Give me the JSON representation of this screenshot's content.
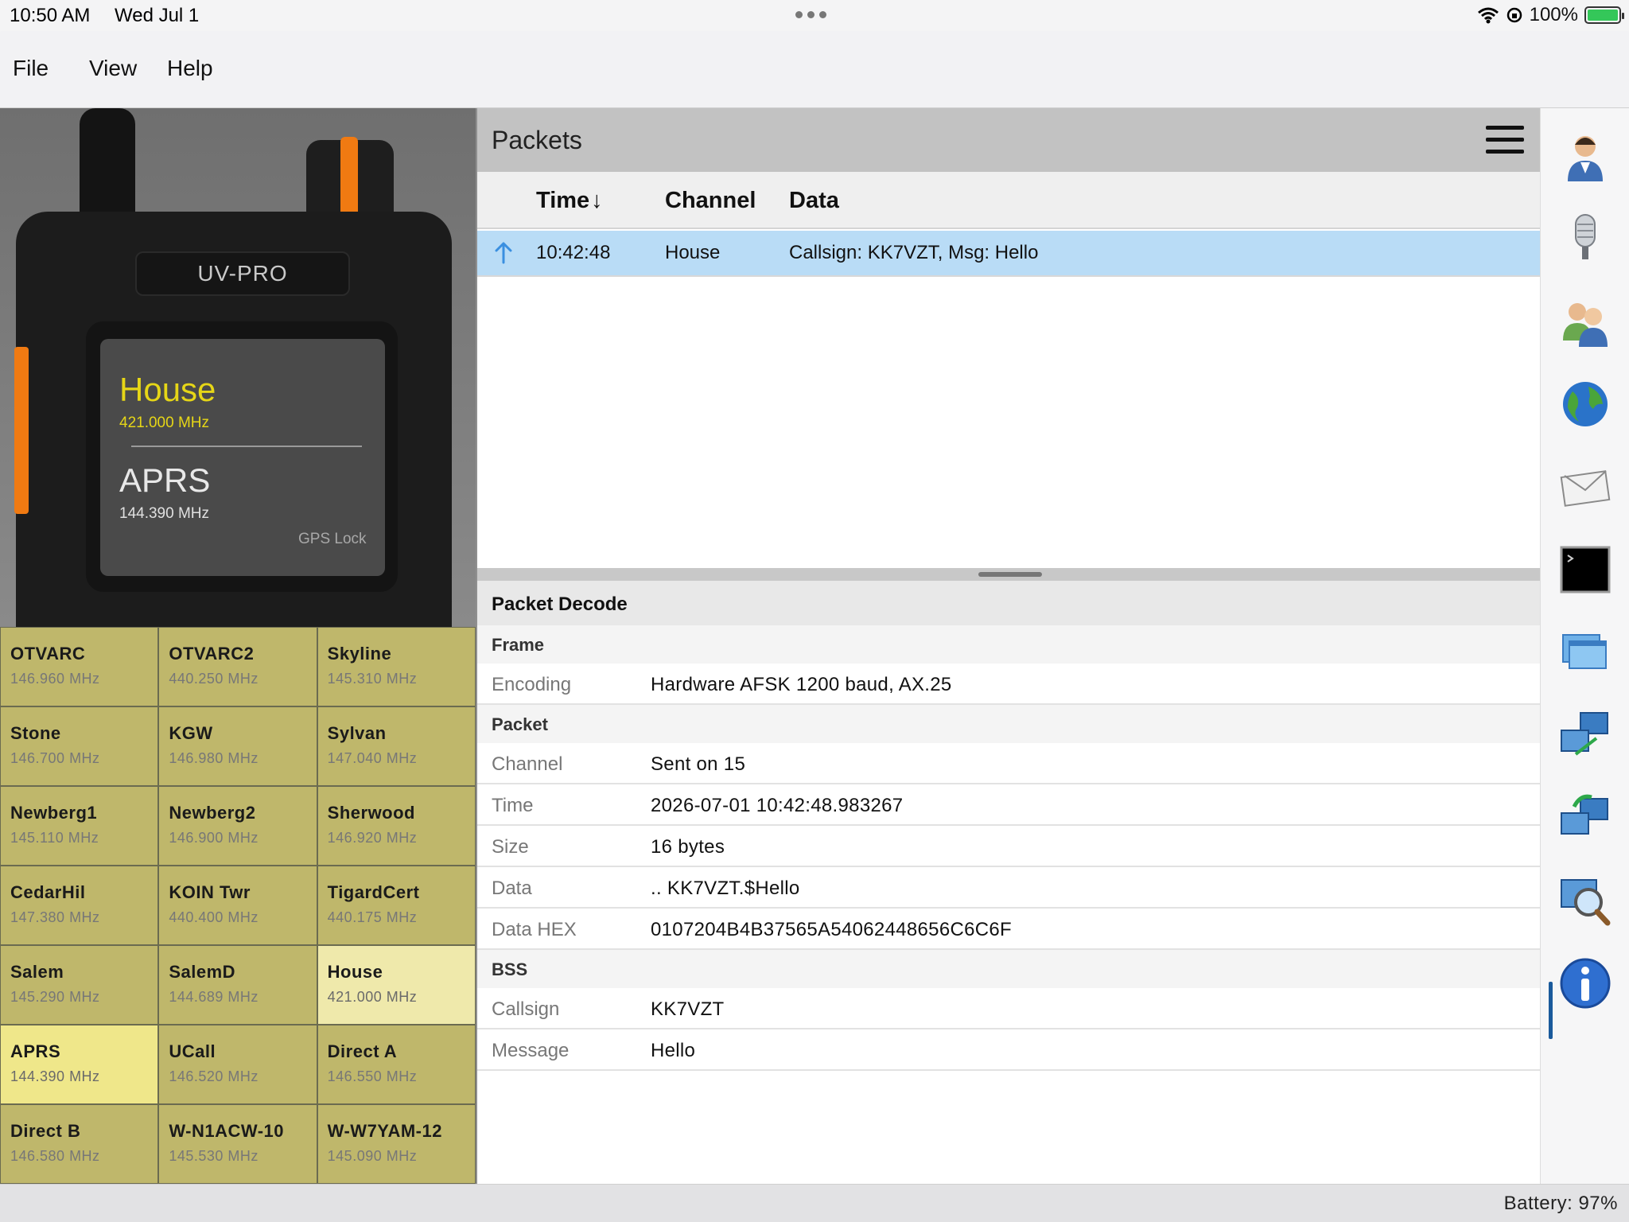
{
  "status_bar": {
    "time": "10:50 AM",
    "date": "Wed Jul 1",
    "battery": "100%"
  },
  "menu": {
    "file": "File",
    "view": "View",
    "help": "Help"
  },
  "radio": {
    "model": "UV-PRO",
    "channel_a": {
      "name": "House",
      "freq": "421.000 MHz"
    },
    "channel_b": {
      "name": "APRS",
      "freq": "144.390 MHz"
    },
    "gps": "GPS Lock"
  },
  "channels": [
    {
      "name": "OTVARC",
      "freq": "146.960 MHz"
    },
    {
      "name": "OTVARC2",
      "freq": "440.250 MHz"
    },
    {
      "name": "Skyline",
      "freq": "145.310 MHz"
    },
    {
      "name": "Stone",
      "freq": "146.700 MHz"
    },
    {
      "name": "KGW",
      "freq": "146.980 MHz"
    },
    {
      "name": "Sylvan",
      "freq": "147.040 MHz"
    },
    {
      "name": "Newberg1",
      "freq": "145.110 MHz"
    },
    {
      "name": "Newberg2",
      "freq": "146.900 MHz"
    },
    {
      "name": "Sherwood",
      "freq": "146.920 MHz"
    },
    {
      "name": "CedarHil",
      "freq": "147.380 MHz"
    },
    {
      "name": "KOIN Twr",
      "freq": "440.400 MHz"
    },
    {
      "name": "TigardCert",
      "freq": "440.175 MHz"
    },
    {
      "name": "Salem",
      "freq": "145.290 MHz"
    },
    {
      "name": "SalemD",
      "freq": "144.689 MHz"
    },
    {
      "name": "House",
      "freq": "421.000 MHz"
    },
    {
      "name": "APRS",
      "freq": "144.390 MHz"
    },
    {
      "name": "UCall",
      "freq": "146.520 MHz"
    },
    {
      "name": "Direct A",
      "freq": "146.550 MHz"
    },
    {
      "name": "Direct B",
      "freq": "146.580 MHz"
    },
    {
      "name": "W-N1ACW-10",
      "freq": "145.530 MHz"
    },
    {
      "name": "W-W7YAM-12",
      "freq": "145.090 MHz"
    }
  ],
  "packets": {
    "title": "Packets",
    "columns": {
      "time": "Time",
      "sort_arrow": "↓",
      "channel": "Channel",
      "data": "Data"
    },
    "rows": [
      {
        "time": "10:42:48",
        "channel": "House",
        "data": "Callsign: KK7VZT, Msg: Hello"
      }
    ]
  },
  "decode": {
    "title": "Packet Decode",
    "sections": [
      {
        "name": "Frame",
        "rows": [
          {
            "key": "Encoding",
            "value": "Hardware AFSK 1200 baud, AX.25"
          }
        ]
      },
      {
        "name": "Packet",
        "rows": [
          {
            "key": "Channel",
            "value": "Sent on 15"
          },
          {
            "key": "Time",
            "value": "2026-07-01 10:42:48.983267"
          },
          {
            "key": "Size",
            "value": "16 bytes"
          },
          {
            "key": "Data",
            "value": ".. KK7VZT.$Hello"
          },
          {
            "key": "Data HEX",
            "value": "0107204B4B37565A54062448656C6C6F"
          }
        ]
      },
      {
        "name": "BSS",
        "rows": [
          {
            "key": "Callsign",
            "value": "KK7VZT"
          },
          {
            "key": "Message",
            "value": "Hello"
          }
        ]
      }
    ]
  },
  "toolbar_icons": [
    "user-headset-icon",
    "microphone-icon",
    "contacts-icon",
    "globe-icon",
    "mail-icon",
    "terminal-icon",
    "windows-icon",
    "network-icon",
    "network-sync-icon",
    "packet-inspect-icon",
    "info-icon"
  ],
  "colors": {
    "channel_bg": "#bfb76b",
    "selected_channel": "#efe78a",
    "row_selected": "#b9dcf6",
    "accent_orange": "#f07a12",
    "screen_yellow": "#e6d617"
  },
  "bottom": {
    "battery": "Battery: 97%"
  }
}
